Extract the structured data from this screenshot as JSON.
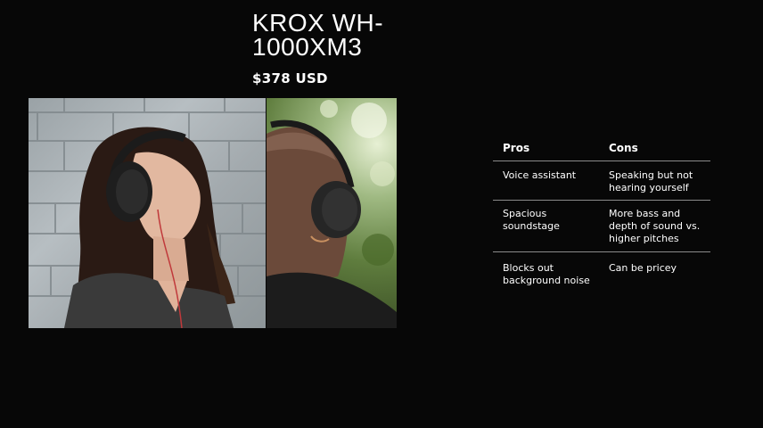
{
  "product": {
    "title": "KROX WH-1000XM3",
    "price": "$378 USD"
  },
  "photos": [
    {
      "name": "woman-with-headphones-photo"
    },
    {
      "name": "man-with-headphones-photo"
    }
  ],
  "table": {
    "headers": {
      "pros": "Pros",
      "cons": "Cons"
    },
    "rows": [
      {
        "pro": "Voice assistant",
        "con": "Speaking but not hearing yourself"
      },
      {
        "pro": "Spacious soundstage",
        "con": "More bass and depth of sound vs. higher pitches"
      },
      {
        "pro": "Blocks out background noise",
        "con": "Can be pricey"
      }
    ]
  },
  "colors": {
    "background": "#070707",
    "text": "#ffffff",
    "divider": "#8a8a8a"
  }
}
